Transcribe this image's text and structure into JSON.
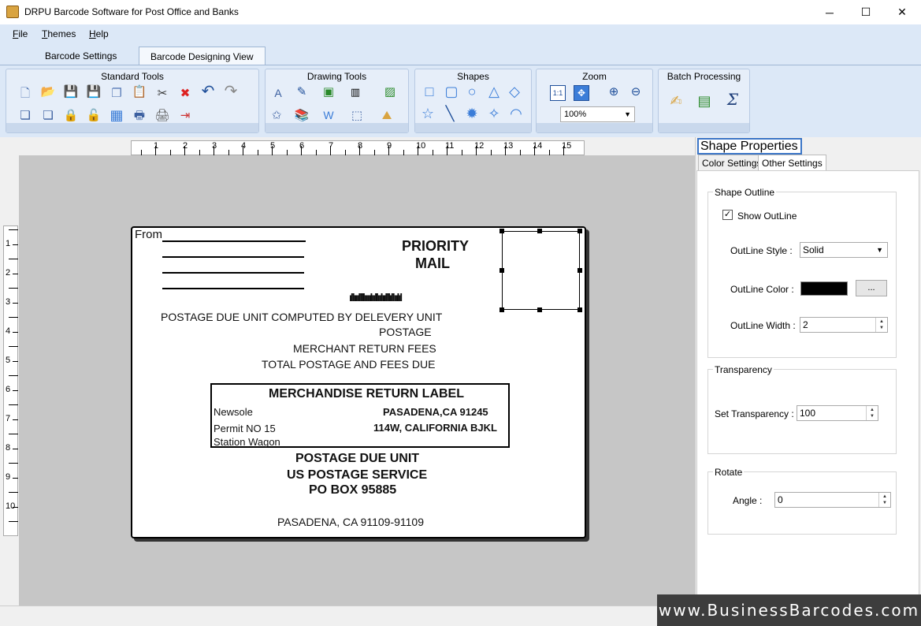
{
  "window": {
    "title": "DRPU Barcode Software for Post Office and Banks",
    "minimize": "─",
    "maximize": "☐",
    "close": "✕"
  },
  "menu": [
    {
      "label": "File"
    },
    {
      "label": "Themes"
    },
    {
      "label": "Help"
    }
  ],
  "tabs": [
    {
      "label": "Barcode Settings",
      "active": false
    },
    {
      "label": "Barcode Designing View",
      "active": true
    }
  ],
  "ribbon": {
    "standard_tools": "Standard Tools",
    "drawing_tools": "Drawing Tools",
    "shapes": "Shapes",
    "zoom": "Zoom",
    "zoom_value": "100%",
    "zoom_fit": "1:1",
    "batch_processing": "Batch Processing",
    "formula": "Σ"
  },
  "ruler": {
    "top": [
      "1",
      "2",
      "3",
      "4",
      "5",
      "6",
      "7",
      "8",
      "9",
      "10",
      "11",
      "12",
      "13",
      "14",
      "15"
    ],
    "left": [
      "1",
      "2",
      "3",
      "4",
      "5",
      "6",
      "7",
      "8",
      "9",
      "10"
    ]
  },
  "label": {
    "from": "From",
    "priority_line1": "PRIORITY",
    "priority_line2": "MAIL",
    "barcode_glyphs": "ıllıııllllıııılııllıılıılllıllıılıl",
    "postage_due_line": "POSTAGE DUE UNIT COMPUTED BY DELEVERY UNIT",
    "postage": "POSTAGE",
    "merchant_fees": "MERCHANT RETURN FEES",
    "total_postage": "TOTAL POSTAGE AND FEES DUE",
    "merch_title": "MERCHANDISE RETURN LABEL",
    "newsole": "Newsole",
    "pasadena_ca": "PASADENA,CA 91245",
    "permit": "Permit NO 15",
    "address": "114W, CALIFORNIA BJKL",
    "station": "Station Wagon",
    "postage_due_unit": "POSTAGE DUE UNIT",
    "us_postage": "US POSTAGE SERVICE",
    "po_box": "PO BOX 95885",
    "city": "PASADENA, CA 91109-91109"
  },
  "panel": {
    "title": "Shape Properties",
    "tab_color": "Color Settings",
    "tab_other": "Other Settings",
    "outline_group": "Shape Outline",
    "show_outline": "Show OutLine",
    "show_outline_checked": true,
    "outline_style_label": "OutLine Style :",
    "outline_style_value": "Solid",
    "outline_color_label": "OutLine Color :",
    "outline_color_value": "#000000",
    "outline_color_btn": "...",
    "outline_width_label": "OutLine Width :",
    "outline_width_value": "2",
    "transparency_group": "Transparency",
    "set_transparency_label": "Set Transparency :",
    "transparency_value": "100",
    "rotate_group": "Rotate",
    "angle_label": "Angle :",
    "angle_value": "0"
  },
  "watermark": "www.BusinessBarcodes.com"
}
